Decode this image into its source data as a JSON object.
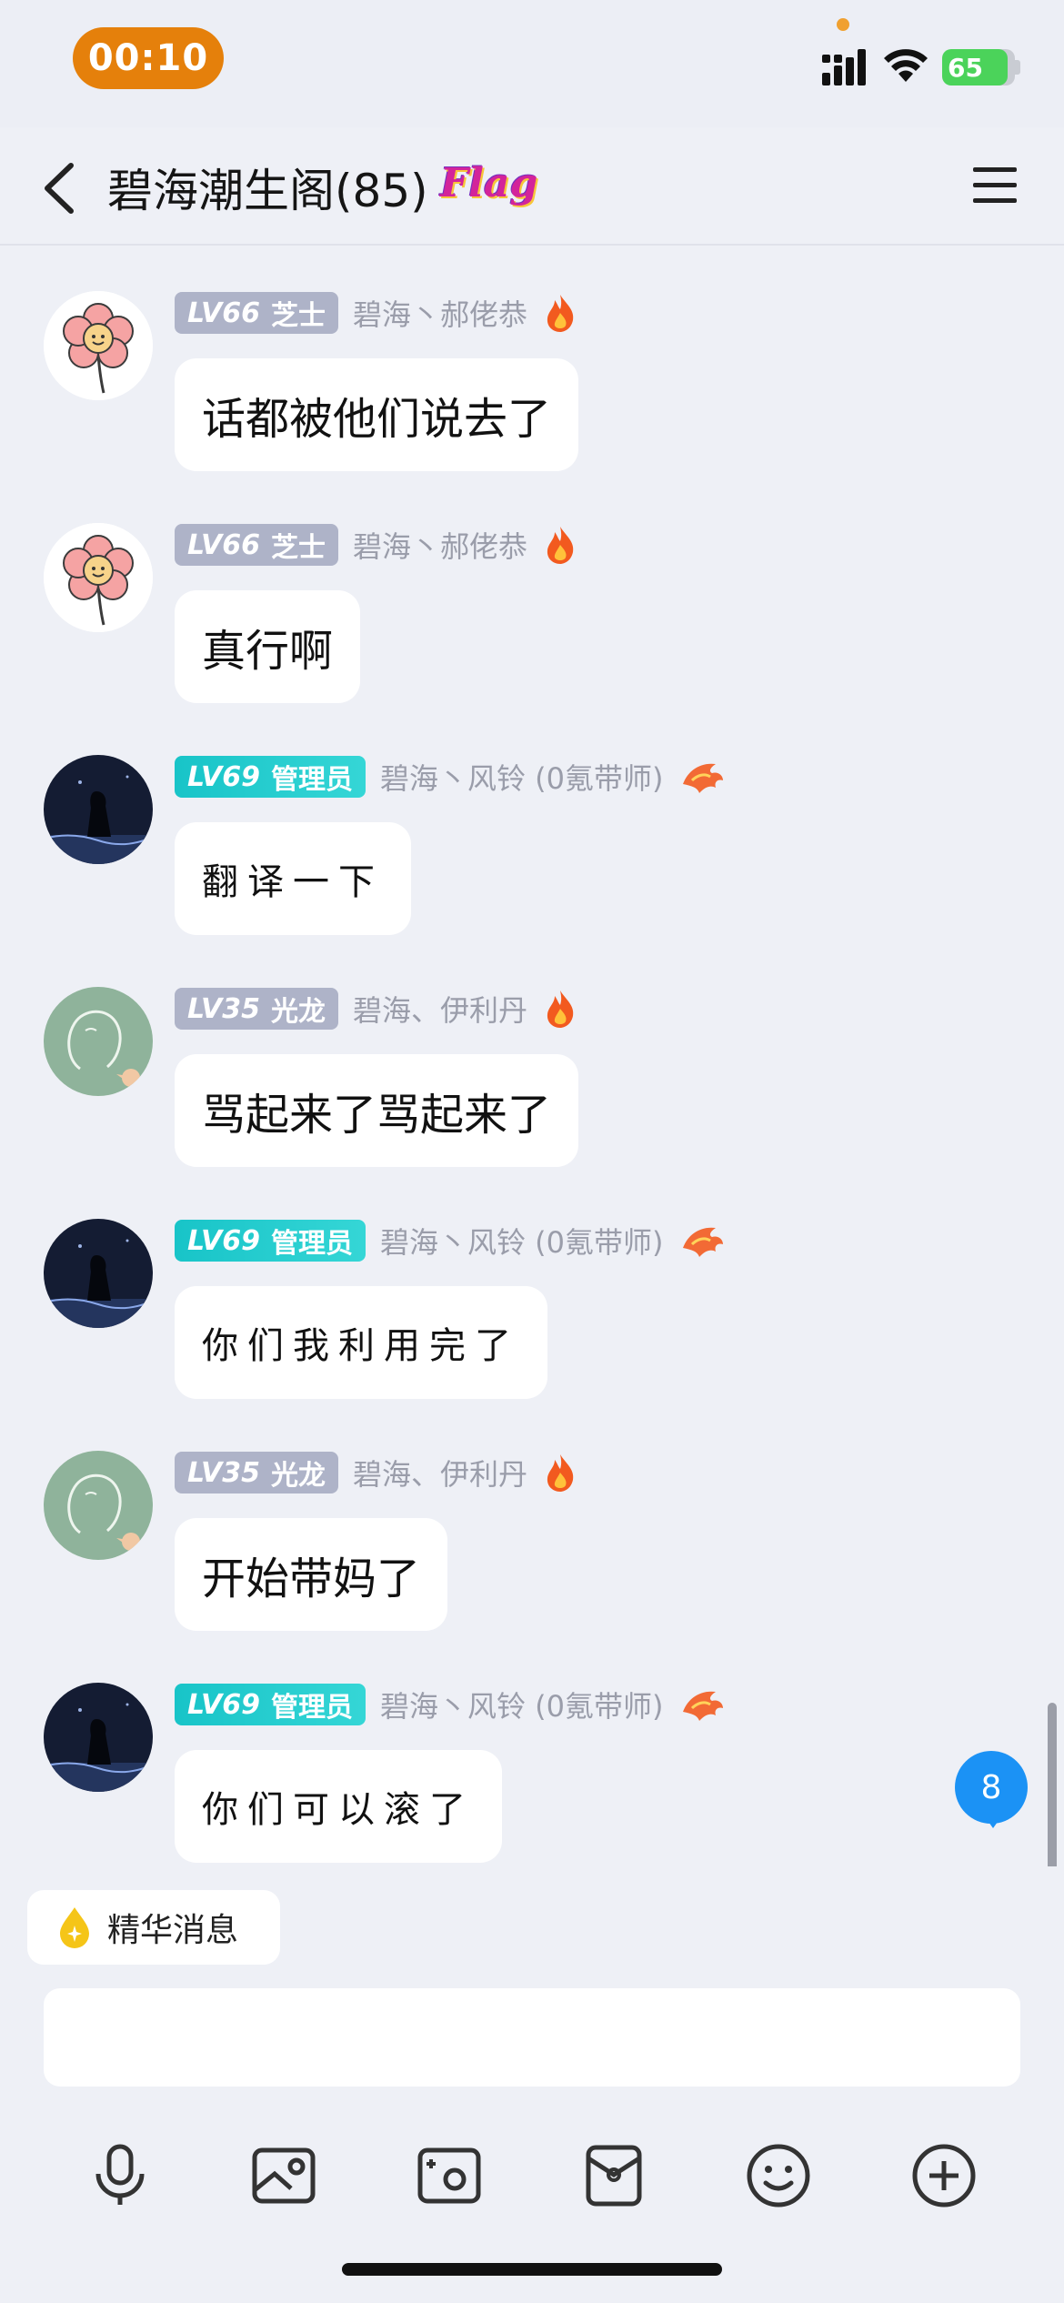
{
  "status_bar": {
    "time": "00:10",
    "battery": "65"
  },
  "header": {
    "back_label": "<",
    "title": "碧海潮生阁(85)",
    "flag_text": "Flag"
  },
  "messages": [
    {
      "avatar": "flower-avatar",
      "level": "LV66",
      "role": "芝士",
      "badge_style": "gray",
      "sender": "碧海丶郝佬恭",
      "sender_icon": "fire-icon",
      "text": "话都被他们说去了",
      "handwritten": false
    },
    {
      "avatar": "flower-avatar",
      "level": "LV66",
      "role": "芝士",
      "badge_style": "gray",
      "sender": "碧海丶郝佬恭",
      "sender_icon": "fire-icon",
      "text": "真行啊",
      "handwritten": false
    },
    {
      "avatar": "night-silhouette-avatar",
      "level": "LV69",
      "role": "管理员",
      "badge_style": "cyan",
      "sender": "碧海丶风铃 (0氪带师)",
      "sender_icon": "dragon-icon",
      "text": "翻译一下",
      "handwritten": true
    },
    {
      "avatar": "green-chalk-avatar",
      "level": "LV35",
      "role": "光龙",
      "badge_style": "gray",
      "sender": "碧海、伊利丹",
      "sender_icon": "fire-icon",
      "text": "骂起来了骂起来了",
      "handwritten": false
    },
    {
      "avatar": "night-silhouette-avatar",
      "level": "LV69",
      "role": "管理员",
      "badge_style": "cyan",
      "sender": "碧海丶风铃 (0氪带师)",
      "sender_icon": "dragon-icon",
      "text": "你们我利用完了",
      "handwritten": true
    },
    {
      "avatar": "green-chalk-avatar",
      "level": "LV35",
      "role": "光龙",
      "badge_style": "gray",
      "sender": "碧海、伊利丹",
      "sender_icon": "fire-icon",
      "text": "开始带妈了",
      "handwritten": false
    },
    {
      "avatar": "night-silhouette-avatar",
      "level": "LV69",
      "role": "管理员",
      "badge_style": "cyan",
      "sender": "碧海丶风铃 (0氪带师)",
      "sender_icon": "dragon-icon",
      "text": "你们可以滚了",
      "handwritten": true
    }
  ],
  "unread_count": "8",
  "essence": {
    "label": "精华消息"
  },
  "input": {
    "value": "",
    "placeholder": ""
  },
  "toolbar_icons": [
    "microphone-icon",
    "image-icon",
    "camera-icon",
    "red-packet-icon",
    "emoji-icon",
    "plus-icon"
  ],
  "colors": {
    "accent_time": "#e5800b",
    "admin_badge": "#18c4c8",
    "member_badge": "#aeb3c8",
    "unread": "#1b92f5"
  }
}
